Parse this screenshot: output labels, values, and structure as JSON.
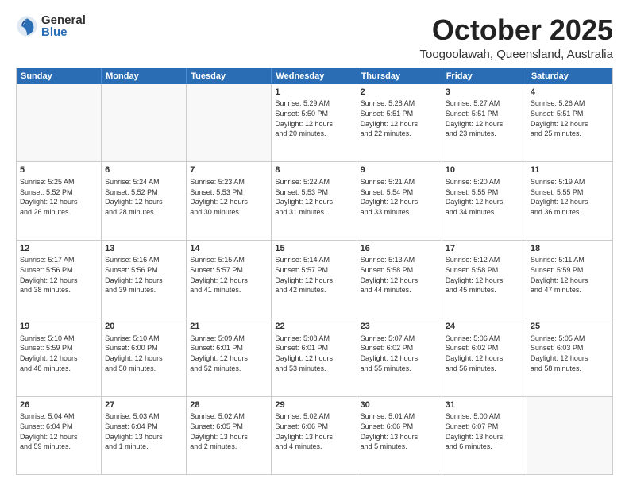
{
  "header": {
    "logo_general": "General",
    "logo_blue": "Blue",
    "title": "October 2025",
    "location": "Toogoolawah, Queensland, Australia"
  },
  "calendar": {
    "days_of_week": [
      "Sunday",
      "Monday",
      "Tuesday",
      "Wednesday",
      "Thursday",
      "Friday",
      "Saturday"
    ],
    "rows": [
      [
        {
          "day": "",
          "info": ""
        },
        {
          "day": "",
          "info": ""
        },
        {
          "day": "",
          "info": ""
        },
        {
          "day": "1",
          "info": "Sunrise: 5:29 AM\nSunset: 5:50 PM\nDaylight: 12 hours\nand 20 minutes."
        },
        {
          "day": "2",
          "info": "Sunrise: 5:28 AM\nSunset: 5:51 PM\nDaylight: 12 hours\nand 22 minutes."
        },
        {
          "day": "3",
          "info": "Sunrise: 5:27 AM\nSunset: 5:51 PM\nDaylight: 12 hours\nand 23 minutes."
        },
        {
          "day": "4",
          "info": "Sunrise: 5:26 AM\nSunset: 5:51 PM\nDaylight: 12 hours\nand 25 minutes."
        }
      ],
      [
        {
          "day": "5",
          "info": "Sunrise: 5:25 AM\nSunset: 5:52 PM\nDaylight: 12 hours\nand 26 minutes."
        },
        {
          "day": "6",
          "info": "Sunrise: 5:24 AM\nSunset: 5:52 PM\nDaylight: 12 hours\nand 28 minutes."
        },
        {
          "day": "7",
          "info": "Sunrise: 5:23 AM\nSunset: 5:53 PM\nDaylight: 12 hours\nand 30 minutes."
        },
        {
          "day": "8",
          "info": "Sunrise: 5:22 AM\nSunset: 5:53 PM\nDaylight: 12 hours\nand 31 minutes."
        },
        {
          "day": "9",
          "info": "Sunrise: 5:21 AM\nSunset: 5:54 PM\nDaylight: 12 hours\nand 33 minutes."
        },
        {
          "day": "10",
          "info": "Sunrise: 5:20 AM\nSunset: 5:55 PM\nDaylight: 12 hours\nand 34 minutes."
        },
        {
          "day": "11",
          "info": "Sunrise: 5:19 AM\nSunset: 5:55 PM\nDaylight: 12 hours\nand 36 minutes."
        }
      ],
      [
        {
          "day": "12",
          "info": "Sunrise: 5:17 AM\nSunset: 5:56 PM\nDaylight: 12 hours\nand 38 minutes."
        },
        {
          "day": "13",
          "info": "Sunrise: 5:16 AM\nSunset: 5:56 PM\nDaylight: 12 hours\nand 39 minutes."
        },
        {
          "day": "14",
          "info": "Sunrise: 5:15 AM\nSunset: 5:57 PM\nDaylight: 12 hours\nand 41 minutes."
        },
        {
          "day": "15",
          "info": "Sunrise: 5:14 AM\nSunset: 5:57 PM\nDaylight: 12 hours\nand 42 minutes."
        },
        {
          "day": "16",
          "info": "Sunrise: 5:13 AM\nSunset: 5:58 PM\nDaylight: 12 hours\nand 44 minutes."
        },
        {
          "day": "17",
          "info": "Sunrise: 5:12 AM\nSunset: 5:58 PM\nDaylight: 12 hours\nand 45 minutes."
        },
        {
          "day": "18",
          "info": "Sunrise: 5:11 AM\nSunset: 5:59 PM\nDaylight: 12 hours\nand 47 minutes."
        }
      ],
      [
        {
          "day": "19",
          "info": "Sunrise: 5:10 AM\nSunset: 5:59 PM\nDaylight: 12 hours\nand 48 minutes."
        },
        {
          "day": "20",
          "info": "Sunrise: 5:10 AM\nSunset: 6:00 PM\nDaylight: 12 hours\nand 50 minutes."
        },
        {
          "day": "21",
          "info": "Sunrise: 5:09 AM\nSunset: 6:01 PM\nDaylight: 12 hours\nand 52 minutes."
        },
        {
          "day": "22",
          "info": "Sunrise: 5:08 AM\nSunset: 6:01 PM\nDaylight: 12 hours\nand 53 minutes."
        },
        {
          "day": "23",
          "info": "Sunrise: 5:07 AM\nSunset: 6:02 PM\nDaylight: 12 hours\nand 55 minutes."
        },
        {
          "day": "24",
          "info": "Sunrise: 5:06 AM\nSunset: 6:02 PM\nDaylight: 12 hours\nand 56 minutes."
        },
        {
          "day": "25",
          "info": "Sunrise: 5:05 AM\nSunset: 6:03 PM\nDaylight: 12 hours\nand 58 minutes."
        }
      ],
      [
        {
          "day": "26",
          "info": "Sunrise: 5:04 AM\nSunset: 6:04 PM\nDaylight: 12 hours\nand 59 minutes."
        },
        {
          "day": "27",
          "info": "Sunrise: 5:03 AM\nSunset: 6:04 PM\nDaylight: 13 hours\nand 1 minute."
        },
        {
          "day": "28",
          "info": "Sunrise: 5:02 AM\nSunset: 6:05 PM\nDaylight: 13 hours\nand 2 minutes."
        },
        {
          "day": "29",
          "info": "Sunrise: 5:02 AM\nSunset: 6:06 PM\nDaylight: 13 hours\nand 4 minutes."
        },
        {
          "day": "30",
          "info": "Sunrise: 5:01 AM\nSunset: 6:06 PM\nDaylight: 13 hours\nand 5 minutes."
        },
        {
          "day": "31",
          "info": "Sunrise: 5:00 AM\nSunset: 6:07 PM\nDaylight: 13 hours\nand 6 minutes."
        },
        {
          "day": "",
          "info": ""
        }
      ]
    ]
  }
}
